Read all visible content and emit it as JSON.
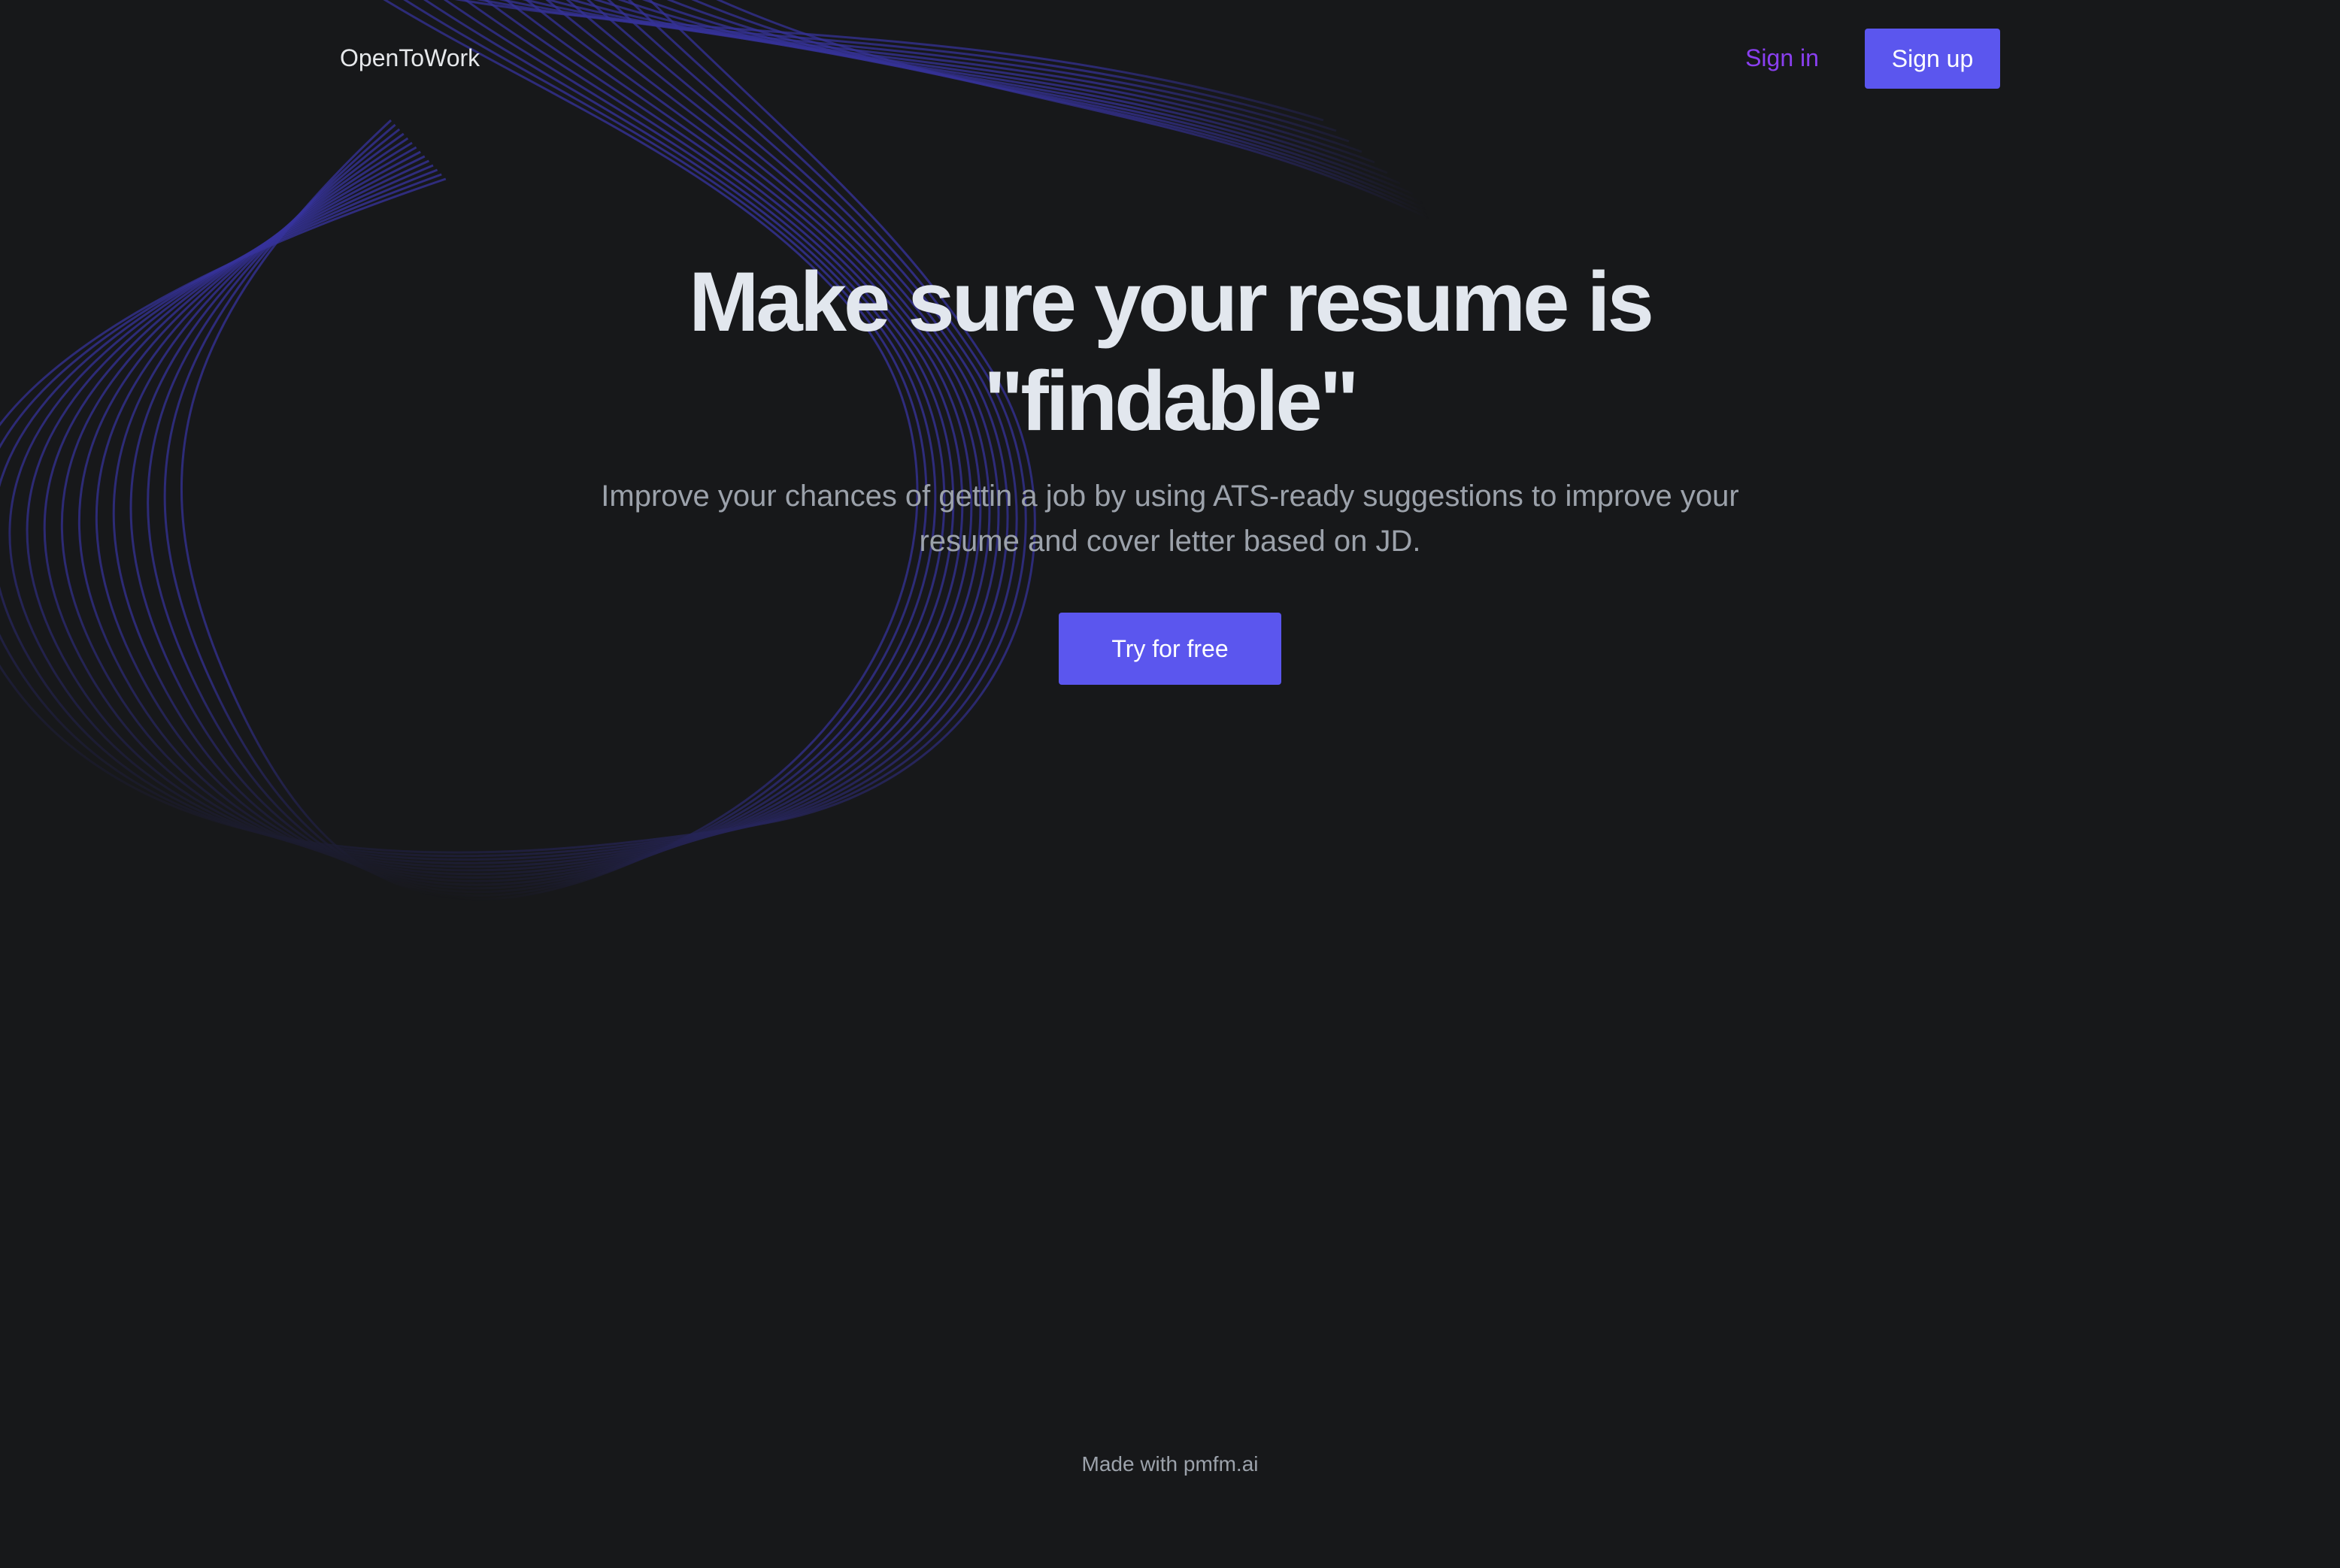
{
  "nav": {
    "logo": "OpenToWork",
    "signin_label": "Sign in",
    "signup_label": "Sign up"
  },
  "hero": {
    "title": "Make sure your resume is \"findable\"",
    "subtitle": "Improve your chances of gettin a job by using ATS-ready suggestions to improve your resume and cover letter based on JD.",
    "cta_label": "Try for free"
  },
  "footer": {
    "text": "Made with pmfm.ai"
  },
  "colors": {
    "background": "#17181a",
    "accent": "#5b56ee",
    "signin_link": "#8a3ff0",
    "heading": "#e2e7ee",
    "muted_text": "#9ca2ab",
    "wave_lines": "#3a36a8"
  }
}
